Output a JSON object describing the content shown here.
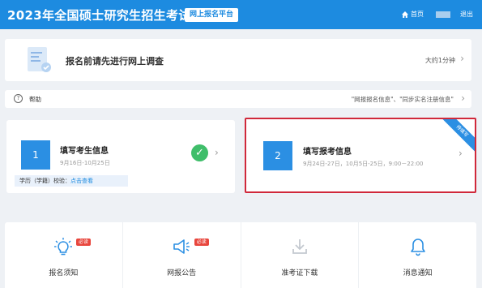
{
  "header": {
    "title": "2023年全国硕士研究生招生考试",
    "platform": "网上报名平台",
    "home": "首页",
    "logout": "退出",
    "home_icon": "home-icon"
  },
  "survey": {
    "title": "报名前请先进行网上调查",
    "time": "大约1分钟"
  },
  "help": {
    "label": "帮助",
    "links": "\"网报报名信息\"、\"同步实名注册信息\""
  },
  "step1": {
    "num": "1",
    "title": "填写考生信息",
    "date": "9月16日-10月25日",
    "footer_prefix": "学历（学籍）校验：",
    "footer_link": "点击查看"
  },
  "step2": {
    "num": "2",
    "title": "填写报考信息",
    "date": "9月24日-27日，10月5日-25日，9:00－22:00",
    "ribbon": "待填写"
  },
  "tiles": [
    {
      "label": "报名须知",
      "badge": "必读",
      "icon": "lightbulb-icon"
    },
    {
      "label": "网报公告",
      "badge": "必读",
      "icon": "megaphone-icon"
    },
    {
      "label": "准考证下载",
      "badge": "",
      "icon": "download-icon"
    },
    {
      "label": "消息通知",
      "badge": "",
      "icon": "bell-icon"
    }
  ],
  "colors": {
    "header": "#1d8be0",
    "highlight_border": "#d0283a",
    "success": "#3fbe6a",
    "badge": "#e8463d"
  }
}
